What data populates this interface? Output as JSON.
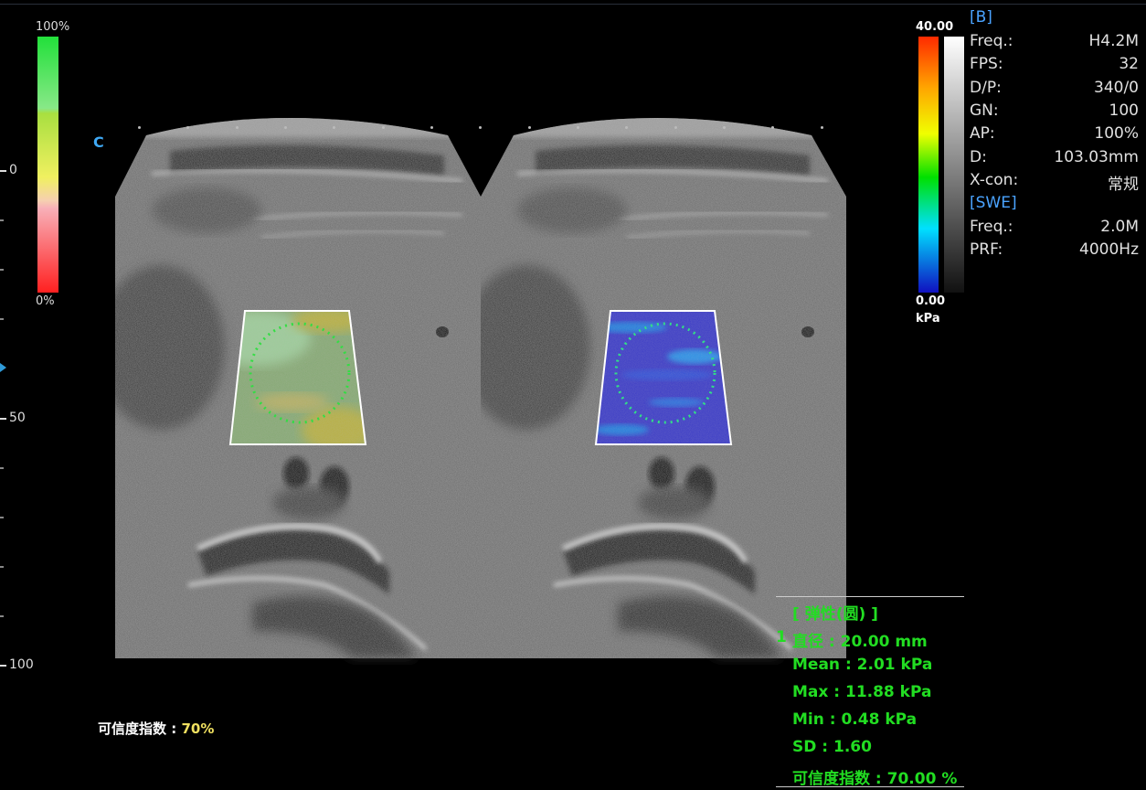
{
  "confidence_scale": {
    "top": "100%",
    "bottom": "0%"
  },
  "depth_scale": {
    "ticks": [
      "0",
      "50",
      "100"
    ]
  },
  "orientation_mark": "C",
  "b_mode": {
    "header": "[B]",
    "params": [
      {
        "label": "Freq.:",
        "value": "H4.2M"
      },
      {
        "label": "FPS:",
        "value": "32"
      },
      {
        "label": "D/P:",
        "value": "340/0"
      },
      {
        "label": "GN:",
        "value": "100"
      },
      {
        "label": "AP:",
        "value": "100%"
      },
      {
        "label": "D:",
        "value": "103.03mm"
      },
      {
        "label": "X-con:",
        "value": "常规"
      }
    ]
  },
  "swe": {
    "header": "[SWE]",
    "params": [
      {
        "label": "Freq.:",
        "value": "2.0M"
      },
      {
        "label": "PRF:",
        "value": "4000Hz"
      }
    ]
  },
  "elasticity_scale": {
    "max": "40.00",
    "min": "0.00",
    "unit": "kPa"
  },
  "measurement": {
    "title": "[ 弹性(圆) ]",
    "index": "1",
    "diameter": "直径 :  20.00 mm",
    "mean": "Mean :  2.01 kPa",
    "max": "Max :  11.88 kPa",
    "min": "Min :  0.48 kPa",
    "sd": "SD :  1.60",
    "confidence": "可信度指数 :  70.00 %"
  },
  "confidence_index": {
    "label": "可信度指数 :",
    "value": "70%"
  }
}
